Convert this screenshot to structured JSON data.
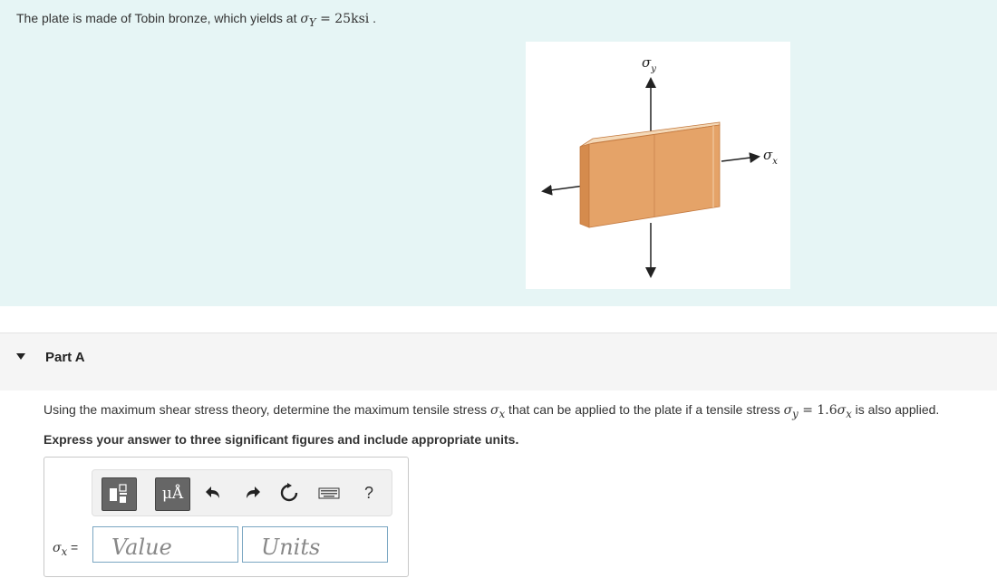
{
  "intro": {
    "text_prefix": "The plate is made of Tobin bronze, which yields at ",
    "sigma_symbol": "σ",
    "yield_subscript": "Y",
    "equals": " = ",
    "yield_value": "25ksi",
    "text_suffix": " ."
  },
  "figure": {
    "sigma_y_label": "σ",
    "sigma_y_sub": "y",
    "sigma_x_label": "σ",
    "sigma_x_sub": "x",
    "colors": {
      "front": "#e5a368",
      "top": "#f4d9b8",
      "side": "#d58b4d",
      "edge": "#c47a40"
    }
  },
  "part": {
    "title": "Part A"
  },
  "question": {
    "text1": "Using the maximum shear stress theory, determine the maximum tensile stress ",
    "sigma": "σ",
    "x_sub": "x",
    "text2": " that can be applied to the plate if a tensile stress ",
    "y_sub": "y",
    "equals": " = ",
    "coef": "1.6",
    "text3": " is also applied."
  },
  "instruction": "Express your answer to three significant figures and include appropriate units.",
  "toolbar": {
    "units_button": "μÅ",
    "help": "?",
    "undo_icon": "undo-icon",
    "redo_icon": "redo-icon",
    "reset_icon": "reset-icon",
    "keyboard_icon": "keyboard-icon"
  },
  "answer": {
    "label_sigma": "σ",
    "label_sub": "x",
    "label_eq": " =",
    "value_placeholder": "Value",
    "units_placeholder": "Units"
  }
}
